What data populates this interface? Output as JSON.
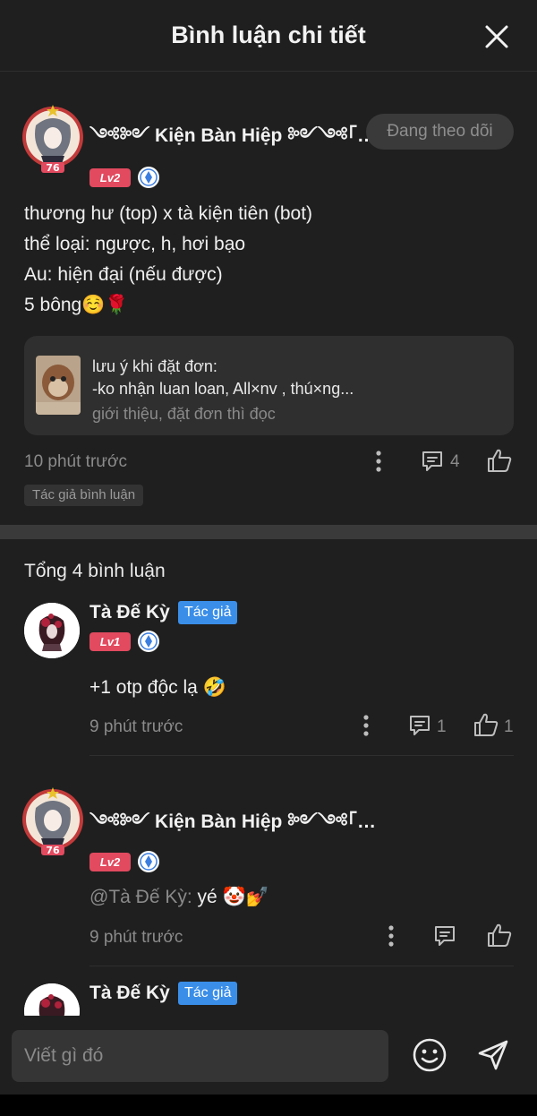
{
  "header": {
    "title": "Bình luận chi tiết",
    "close_icon": "close-icon"
  },
  "post": {
    "author": "༺༻ Kiện Bàn Hiệp ༻༺「 健斑侠 」",
    "follow_label": "Đang theo dõi",
    "level": "Lv2",
    "avatar_badge_number": "76",
    "lines": [
      "thương hư (top) x tà kiện tiên (bot)",
      "thể loại: ngược, h, hơi bạo",
      "Au: hiện đại (nếu được)",
      "5 bông☺️🌹"
    ],
    "link_card": {
      "title": "lưu ý khi đặt đơn:",
      "desc": "-ko nhận luan loan, All×nv , thú×ng...",
      "sub": "giới thiệu, đặt đơn thì đọc"
    },
    "time": "10 phút trước",
    "reply_count": "4",
    "tag": "Tác giả bình luận"
  },
  "total_label": "Tổng 4 bình luận",
  "comments": [
    {
      "author": "Tà Đế Kỳ",
      "author_badge": "Tác giả",
      "level": "Lv1",
      "text": "+1 otp độc lạ 🤣",
      "time": "9 phút trước",
      "reply_count": "1",
      "like_count": "1"
    },
    {
      "author": "༺༻ Kiện Bàn Hiệp ༻༺「 健斑侠 」",
      "level": "Lv2",
      "avatar_badge_number": "76",
      "mention": "@Tà Đế Kỳ:",
      "text": " yé 🤡💅",
      "time": "9 phút trước"
    },
    {
      "author": "Tà Đế Kỳ",
      "author_badge": "Tác giả"
    }
  ],
  "input": {
    "placeholder": "Viết gì đó"
  },
  "colors": {
    "background": "#1f1f1f",
    "level_badge": "#e24a5f",
    "author_badge": "#3a8ee8",
    "muted": "#8b8b8b"
  }
}
